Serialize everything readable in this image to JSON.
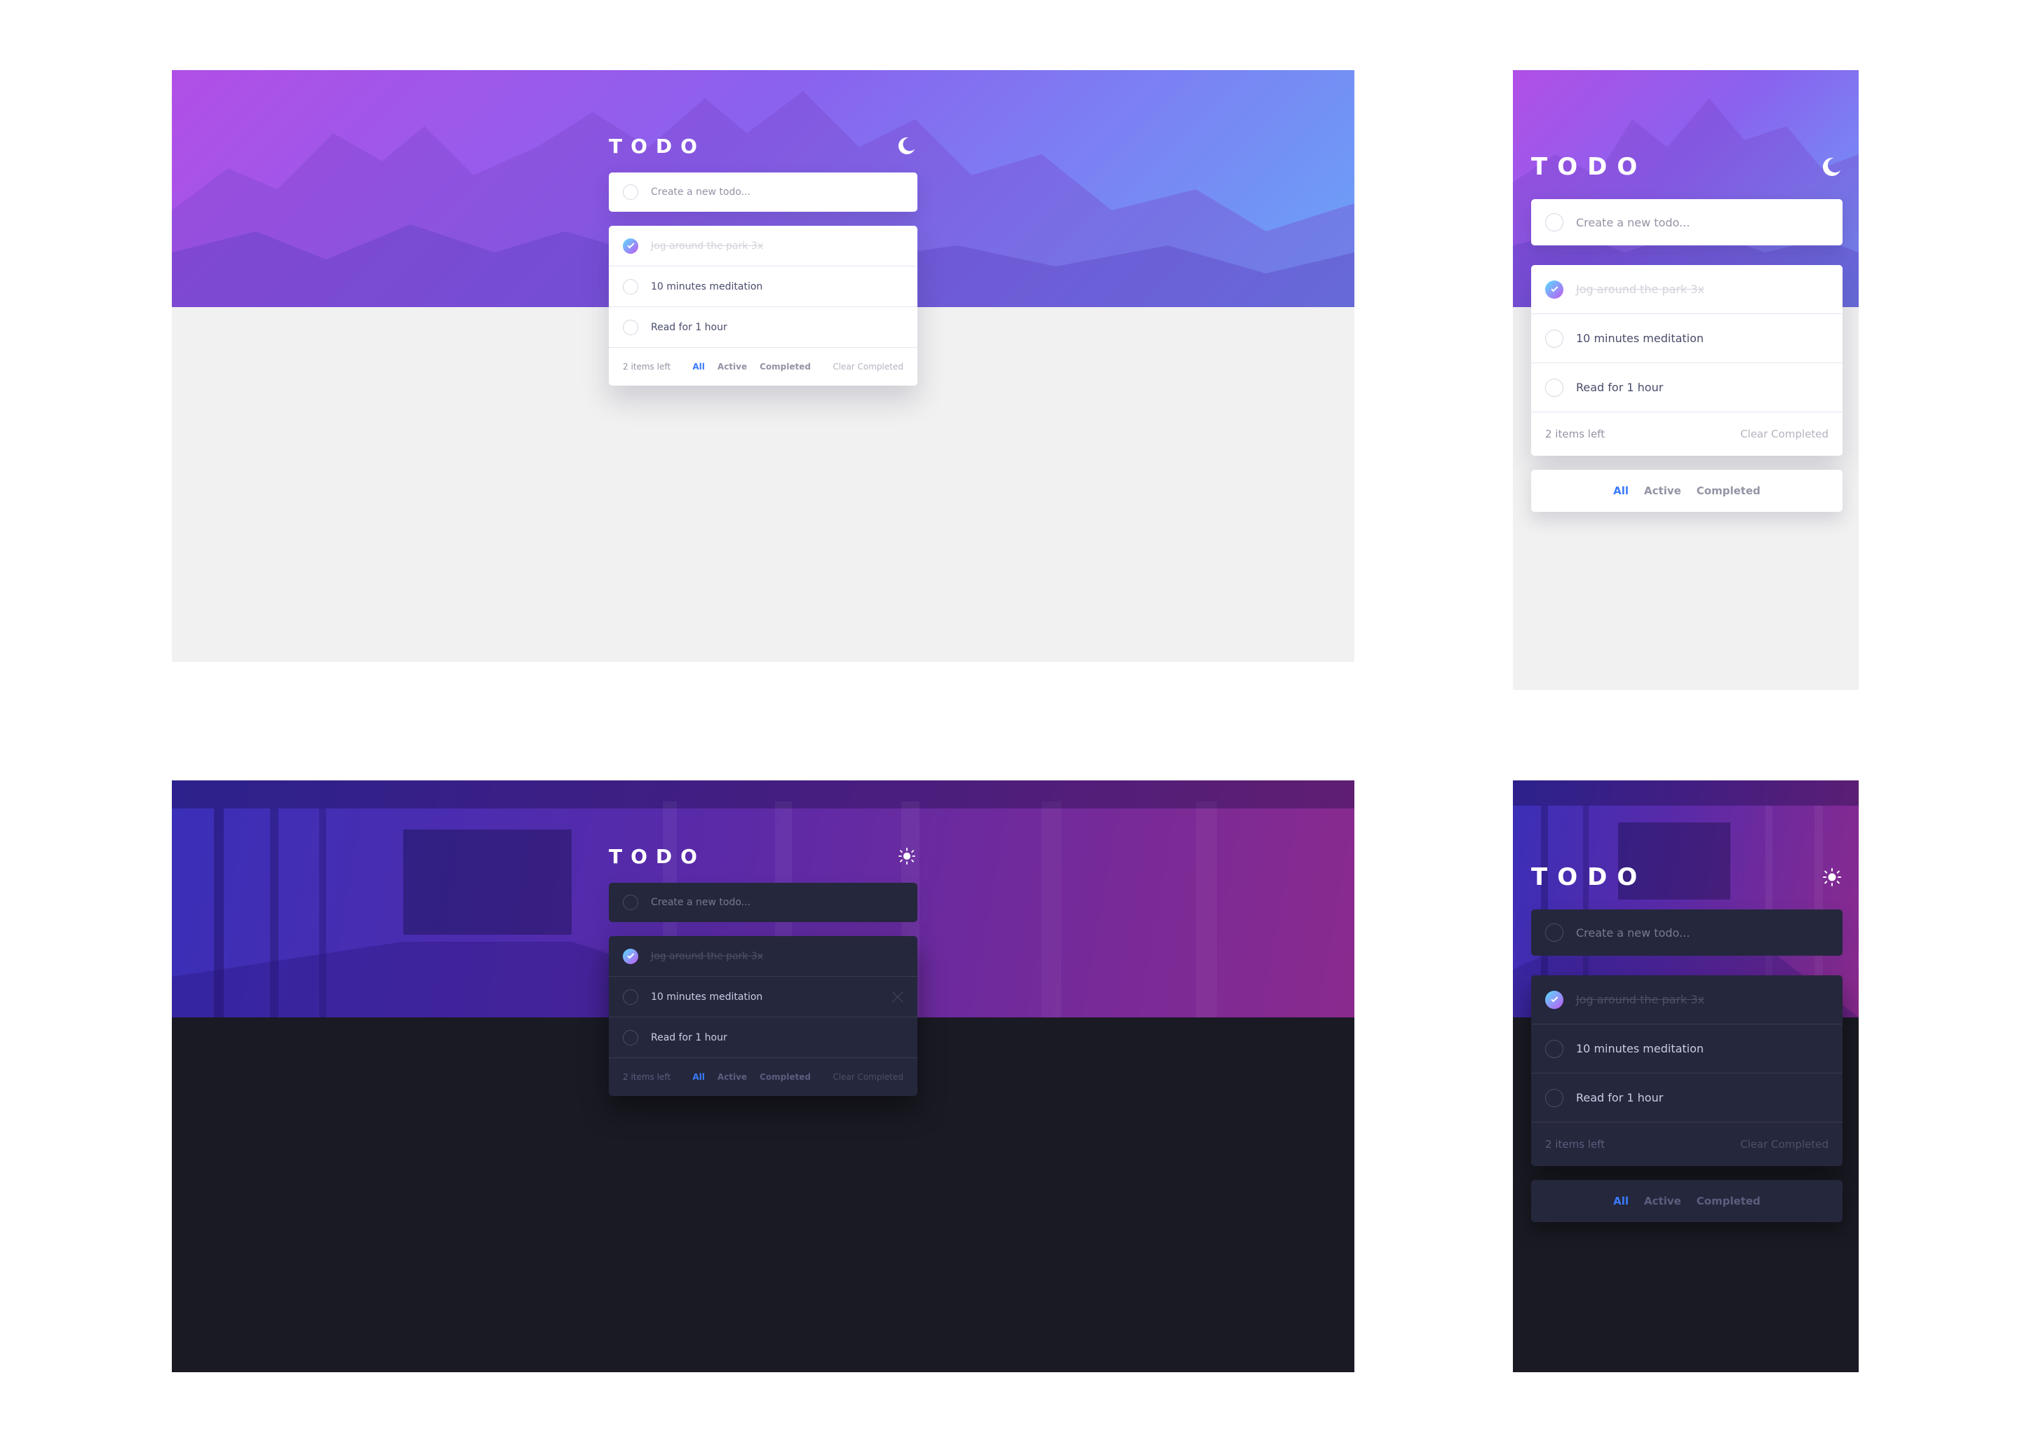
{
  "app": {
    "title": "TODO"
  },
  "input": {
    "placeholder": "Create a new todo..."
  },
  "todos": [
    {
      "text": "Jog around the park 3x",
      "completed": true
    },
    {
      "text": "10 minutes meditation",
      "completed": false
    },
    {
      "text": "Read for 1 hour",
      "completed": false
    }
  ],
  "footer": {
    "items_left": "2 items left",
    "filters": [
      "All",
      "Active",
      "Completed"
    ],
    "active_filter": "All",
    "clear_label": "Clear Completed"
  },
  "icons": {
    "light_theme_toggle": "moon-icon",
    "dark_theme_toggle": "sun-icon",
    "check": "check-icon",
    "delete": "cross-icon"
  },
  "colors": {
    "bright_blue": "#3a7bfd",
    "check_gradient_start": "#57ddff",
    "check_gradient_end": "#c058f3",
    "light_bg": "#f1f1f1",
    "dark_bg": "#1a1a24",
    "dark_card": "#25273c"
  }
}
